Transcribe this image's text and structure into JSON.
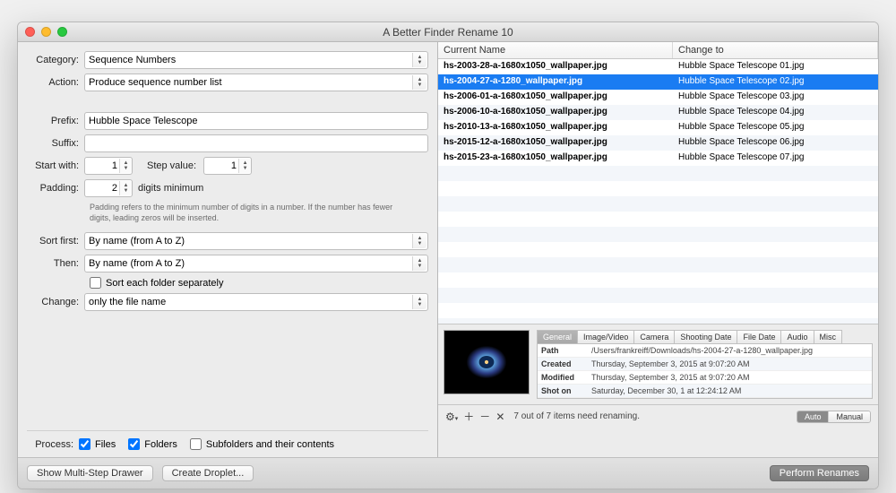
{
  "window_title": "A Better Finder Rename 10",
  "labels": {
    "category": "Category:",
    "action": "Action:",
    "prefix": "Prefix:",
    "suffix": "Suffix:",
    "start_with": "Start with:",
    "step_value": "Step value:",
    "padding": "Padding:",
    "digits_min": "digits minimum",
    "help": "Padding refers to the minimum number of digits in a number. If the number has fewer digits, leading zeros will be inserted.",
    "sort_first": "Sort first:",
    "then": "Then:",
    "sort_each": "Sort each folder separately",
    "change": "Change:",
    "process": "Process:",
    "files": "Files",
    "folders": "Folders",
    "subfolders": "Subfolders and their contents"
  },
  "values": {
    "category": "Sequence Numbers",
    "action": "Produce sequence number list",
    "prefix": "Hubble Space Telescope",
    "suffix": "",
    "start_with": "1",
    "step_value": "1",
    "padding": "2",
    "sort_first": "By name (from A to Z)",
    "then": "By name (from A to Z)",
    "sort_each_checked": false,
    "change": "only the file name",
    "files_checked": true,
    "folders_checked": true,
    "subfolders_checked": false
  },
  "columns": {
    "c1": "Current Name",
    "c2": "Change to"
  },
  "rows": [
    {
      "current": "hs-2003-28-a-1680x1050_wallpaper.jpg",
      "new": "Hubble Space Telescope 01.jpg",
      "selected": false
    },
    {
      "current": "hs-2004-27-a-1280_wallpaper.jpg",
      "new": "Hubble Space Telescope 02.jpg",
      "selected": true
    },
    {
      "current": "hs-2006-01-a-1680x1050_wallpaper.jpg",
      "new": "Hubble Space Telescope 03.jpg",
      "selected": false
    },
    {
      "current": "hs-2006-10-a-1680x1050_wallpaper.jpg",
      "new": "Hubble Space Telescope 04.jpg",
      "selected": false
    },
    {
      "current": "hs-2010-13-a-1680x1050_wallpaper.jpg",
      "new": "Hubble Space Telescope 05.jpg",
      "selected": false
    },
    {
      "current": "hs-2015-12-a-1680x1050_wallpaper.jpg",
      "new": "Hubble Space Telescope 06.jpg",
      "selected": false
    },
    {
      "current": "hs-2015-23-a-1680x1050_wallpaper.jpg",
      "new": "Hubble Space Telescope 07.jpg",
      "selected": false
    }
  ],
  "tabs": [
    "General",
    "Image/Video",
    "Camera",
    "Shooting Date",
    "File Date",
    "Audio",
    "Misc"
  ],
  "active_tab": 0,
  "meta": [
    {
      "k": "Path",
      "v": "/Users/frankreiff/Downloads/hs-2004-27-a-1280_wallpaper.jpg"
    },
    {
      "k": "Created",
      "v": "Thursday, September 3, 2015 at 9:07:20 AM"
    },
    {
      "k": "Modified",
      "v": "Thursday, September 3, 2015 at 9:07:20 AM"
    },
    {
      "k": "Shot on",
      "v": "Saturday, December 30, 1 at 12:24:12 AM"
    }
  ],
  "status": {
    "text": "7 out of 7 items need renaming.",
    "seg_auto": "Auto",
    "seg_manual": "Manual"
  },
  "buttons": {
    "show_drawer": "Show Multi-Step Drawer",
    "create_droplet": "Create Droplet...",
    "perform": "Perform Renames"
  }
}
